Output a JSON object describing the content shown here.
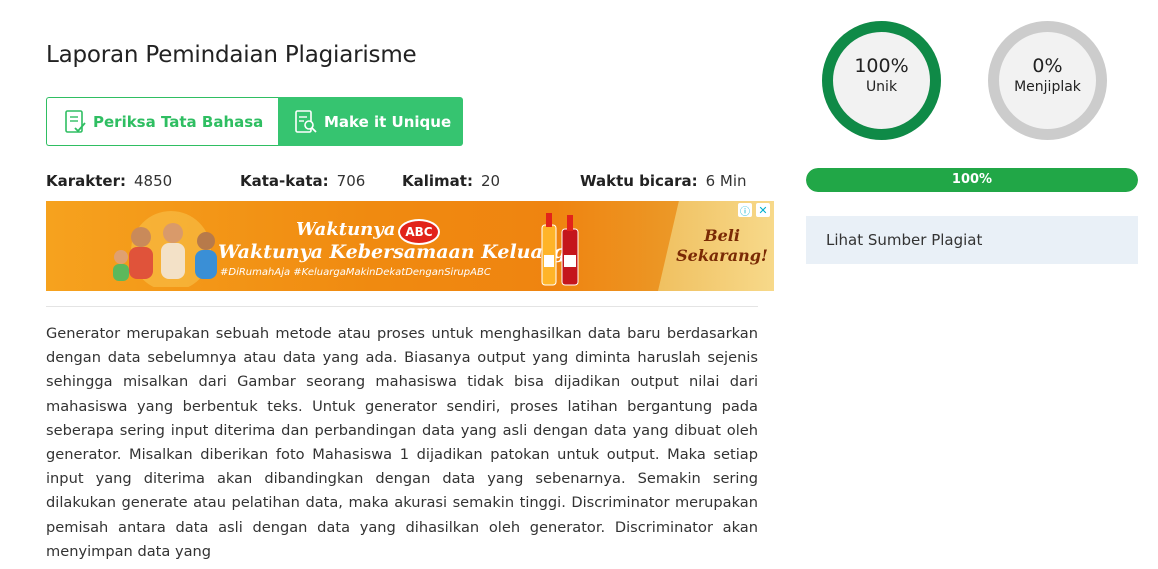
{
  "report": {
    "title": "Laporan Pemindaian Plagiarisme",
    "grammar_button": "Periksa Tata Bahasa",
    "unique_button": "Make it Unique"
  },
  "stats": {
    "characters_label": "Karakter:",
    "characters_value": "4850",
    "words_label": "Kata-kata:",
    "words_value": "706",
    "sentences_label": "Kalimat:",
    "sentences_value": "20",
    "speak_time_label": "Waktu bicara:",
    "speak_time_value": "6 Min"
  },
  "ad": {
    "headline": "Waktunya",
    "logo_text": "ABC",
    "subline": "Waktunya Kebersamaan Keluarga",
    "hashtags": "#DiRumahAja #KeluargaMakinDekatDenganSirupABC",
    "cta_line1": "Beli",
    "cta_line2": "Sekarang!",
    "info_icon": "ⓘ",
    "close_icon": "✕"
  },
  "content": {
    "text": "Generator merupakan sebuah metode atau proses untuk menghasilkan data baru berdasarkan dengan data sebelumnya atau data yang ada. Biasanya output yang diminta haruslah sejenis sehingga misalkan dari Gambar seorang mahasiswa tidak bisa dijadikan output nilai dari mahasiswa yang berbentuk teks. Untuk generator sendiri, proses latihan bergantung pada seberapa sering input diterima dan perbandingan data yang asli dengan data yang dibuat oleh generator. Misalkan diberikan foto Mahasiswa 1 dijadikan patokan untuk output. Maka setiap input yang diterima akan dibandingkan dengan data yang sebenarnya. Semakin sering dilakukan generate atau pelatihan data, maka akurasi semakin tinggi. Discriminator merupakan pemisah antara data asli dengan data yang dihasilkan oleh generator. Discriminator akan menyimpan data yang"
  },
  "results": {
    "unique_percent": "100%",
    "unique_label": "Unik",
    "unique_fraction": 1.0,
    "plagiarized_percent": "0%",
    "plagiarized_label": "Menjiplak",
    "plagiarized_fraction": 0.0,
    "progress_text": "100%",
    "progress_fraction": 1.0,
    "sources_link": "Lihat Sumber Plagiat"
  },
  "colors": {
    "accent_green": "#36c470",
    "unique_ring": "#0f8a47",
    "plagiarized_ring": "#cccccc",
    "progress_fill": "#21a747",
    "sources_bg": "#e9f0f7"
  }
}
